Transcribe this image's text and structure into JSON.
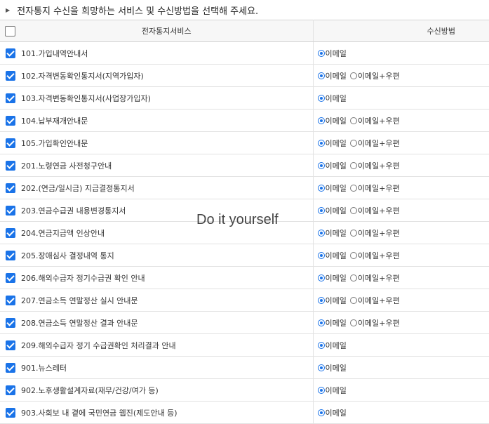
{
  "heading": "전자통지 수신을 희망하는 서비스 및 수신방법을 선택해 주세요.",
  "columns": {
    "service": "전자통지서비스",
    "method": "수신방법"
  },
  "option_labels": {
    "email": "이메일",
    "email_post": "이메일+우편"
  },
  "watermark": "Do it yourself",
  "colors": {
    "accent": "#1a73e8"
  },
  "rows": [
    {
      "label": "101.가입내역안내서",
      "checked": true,
      "options": [
        "email"
      ]
    },
    {
      "label": "102.자격변동확인통지서(지역가입자)",
      "checked": true,
      "options": [
        "email",
        "email_post"
      ]
    },
    {
      "label": "103.자격변동확인통지서(사업장가입자)",
      "checked": true,
      "options": [
        "email"
      ]
    },
    {
      "label": "104.납부재개안내문",
      "checked": true,
      "options": [
        "email",
        "email_post"
      ]
    },
    {
      "label": "105.가입확인안내문",
      "checked": true,
      "options": [
        "email",
        "email_post"
      ]
    },
    {
      "label": "201.노령연금 사전청구안내",
      "checked": true,
      "options": [
        "email",
        "email_post"
      ]
    },
    {
      "label": "202.(연금/일시금) 지급결정통지서",
      "checked": true,
      "options": [
        "email",
        "email_post"
      ]
    },
    {
      "label": "203.연금수급권 내용변경통지서",
      "checked": true,
      "options": [
        "email",
        "email_post"
      ]
    },
    {
      "label": "204.연금지급액 인상안내",
      "checked": true,
      "options": [
        "email",
        "email_post"
      ]
    },
    {
      "label": "205.장애심사 결정내역 통지",
      "checked": true,
      "options": [
        "email",
        "email_post"
      ]
    },
    {
      "label": "206.해외수급자 정기수급권 확인 안내",
      "checked": true,
      "options": [
        "email",
        "email_post"
      ]
    },
    {
      "label": "207.연금소득 연말정산 실시 안내문",
      "checked": true,
      "options": [
        "email",
        "email_post"
      ]
    },
    {
      "label": "208.연금소득 연말정산 결과 안내문",
      "checked": true,
      "options": [
        "email",
        "email_post"
      ]
    },
    {
      "label": "209.해외수급자 정기 수급권확인 처리결과 안내",
      "checked": true,
      "options": [
        "email"
      ]
    },
    {
      "label": "901.뉴스레터",
      "checked": true,
      "options": [
        "email"
      ]
    },
    {
      "label": "902.노후생활설계자료(재무/건강/여가 등)",
      "checked": true,
      "options": [
        "email"
      ]
    },
    {
      "label": "903.사회보 내 곁에 국민연금 웹진(제도안내 등)",
      "checked": true,
      "options": [
        "email"
      ]
    }
  ]
}
